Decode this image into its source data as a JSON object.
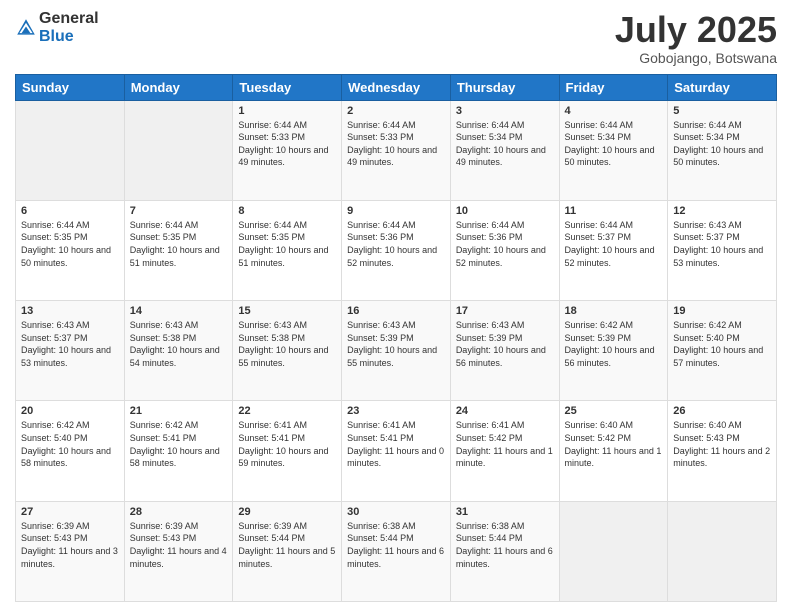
{
  "logo": {
    "general": "General",
    "blue": "Blue"
  },
  "title": "July 2025",
  "location": "Gobojango, Botswana",
  "days_of_week": [
    "Sunday",
    "Monday",
    "Tuesday",
    "Wednesday",
    "Thursday",
    "Friday",
    "Saturday"
  ],
  "weeks": [
    [
      {
        "day": "",
        "info": ""
      },
      {
        "day": "",
        "info": ""
      },
      {
        "day": "1",
        "info": "Sunrise: 6:44 AM\nSunset: 5:33 PM\nDaylight: 10 hours and 49 minutes."
      },
      {
        "day": "2",
        "info": "Sunrise: 6:44 AM\nSunset: 5:33 PM\nDaylight: 10 hours and 49 minutes."
      },
      {
        "day": "3",
        "info": "Sunrise: 6:44 AM\nSunset: 5:34 PM\nDaylight: 10 hours and 49 minutes."
      },
      {
        "day": "4",
        "info": "Sunrise: 6:44 AM\nSunset: 5:34 PM\nDaylight: 10 hours and 50 minutes."
      },
      {
        "day": "5",
        "info": "Sunrise: 6:44 AM\nSunset: 5:34 PM\nDaylight: 10 hours and 50 minutes."
      }
    ],
    [
      {
        "day": "6",
        "info": "Sunrise: 6:44 AM\nSunset: 5:35 PM\nDaylight: 10 hours and 50 minutes."
      },
      {
        "day": "7",
        "info": "Sunrise: 6:44 AM\nSunset: 5:35 PM\nDaylight: 10 hours and 51 minutes."
      },
      {
        "day": "8",
        "info": "Sunrise: 6:44 AM\nSunset: 5:35 PM\nDaylight: 10 hours and 51 minutes."
      },
      {
        "day": "9",
        "info": "Sunrise: 6:44 AM\nSunset: 5:36 PM\nDaylight: 10 hours and 52 minutes."
      },
      {
        "day": "10",
        "info": "Sunrise: 6:44 AM\nSunset: 5:36 PM\nDaylight: 10 hours and 52 minutes."
      },
      {
        "day": "11",
        "info": "Sunrise: 6:44 AM\nSunset: 5:37 PM\nDaylight: 10 hours and 52 minutes."
      },
      {
        "day": "12",
        "info": "Sunrise: 6:43 AM\nSunset: 5:37 PM\nDaylight: 10 hours and 53 minutes."
      }
    ],
    [
      {
        "day": "13",
        "info": "Sunrise: 6:43 AM\nSunset: 5:37 PM\nDaylight: 10 hours and 53 minutes."
      },
      {
        "day": "14",
        "info": "Sunrise: 6:43 AM\nSunset: 5:38 PM\nDaylight: 10 hours and 54 minutes."
      },
      {
        "day": "15",
        "info": "Sunrise: 6:43 AM\nSunset: 5:38 PM\nDaylight: 10 hours and 55 minutes."
      },
      {
        "day": "16",
        "info": "Sunrise: 6:43 AM\nSunset: 5:39 PM\nDaylight: 10 hours and 55 minutes."
      },
      {
        "day": "17",
        "info": "Sunrise: 6:43 AM\nSunset: 5:39 PM\nDaylight: 10 hours and 56 minutes."
      },
      {
        "day": "18",
        "info": "Sunrise: 6:42 AM\nSunset: 5:39 PM\nDaylight: 10 hours and 56 minutes."
      },
      {
        "day": "19",
        "info": "Sunrise: 6:42 AM\nSunset: 5:40 PM\nDaylight: 10 hours and 57 minutes."
      }
    ],
    [
      {
        "day": "20",
        "info": "Sunrise: 6:42 AM\nSunset: 5:40 PM\nDaylight: 10 hours and 58 minutes."
      },
      {
        "day": "21",
        "info": "Sunrise: 6:42 AM\nSunset: 5:41 PM\nDaylight: 10 hours and 58 minutes."
      },
      {
        "day": "22",
        "info": "Sunrise: 6:41 AM\nSunset: 5:41 PM\nDaylight: 10 hours and 59 minutes."
      },
      {
        "day": "23",
        "info": "Sunrise: 6:41 AM\nSunset: 5:41 PM\nDaylight: 11 hours and 0 minutes."
      },
      {
        "day": "24",
        "info": "Sunrise: 6:41 AM\nSunset: 5:42 PM\nDaylight: 11 hours and 1 minute."
      },
      {
        "day": "25",
        "info": "Sunrise: 6:40 AM\nSunset: 5:42 PM\nDaylight: 11 hours and 1 minute."
      },
      {
        "day": "26",
        "info": "Sunrise: 6:40 AM\nSunset: 5:43 PM\nDaylight: 11 hours and 2 minutes."
      }
    ],
    [
      {
        "day": "27",
        "info": "Sunrise: 6:39 AM\nSunset: 5:43 PM\nDaylight: 11 hours and 3 minutes."
      },
      {
        "day": "28",
        "info": "Sunrise: 6:39 AM\nSunset: 5:43 PM\nDaylight: 11 hours and 4 minutes."
      },
      {
        "day": "29",
        "info": "Sunrise: 6:39 AM\nSunset: 5:44 PM\nDaylight: 11 hours and 5 minutes."
      },
      {
        "day": "30",
        "info": "Sunrise: 6:38 AM\nSunset: 5:44 PM\nDaylight: 11 hours and 6 minutes."
      },
      {
        "day": "31",
        "info": "Sunrise: 6:38 AM\nSunset: 5:44 PM\nDaylight: 11 hours and 6 minutes."
      },
      {
        "day": "",
        "info": ""
      },
      {
        "day": "",
        "info": ""
      }
    ]
  ]
}
